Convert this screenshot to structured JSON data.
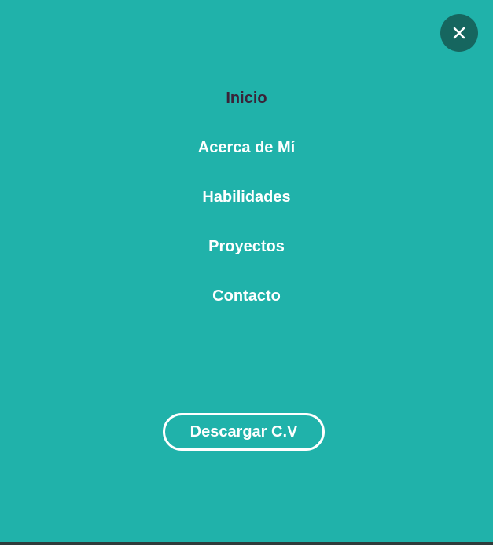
{
  "menu": {
    "close_icon": "close-icon",
    "items": [
      {
        "label": "Inicio",
        "active": true
      },
      {
        "label": "Acerca de Mí",
        "active": false
      },
      {
        "label": "Habilidades",
        "active": false
      },
      {
        "label": "Proyectos",
        "active": false
      },
      {
        "label": "Contacto",
        "active": false
      }
    ],
    "cv_button_label": "Descargar C.V"
  },
  "colors": {
    "background": "#20b2aa",
    "close_button": "#16665f",
    "active_link": "#3a2338",
    "link": "#ffffff"
  }
}
